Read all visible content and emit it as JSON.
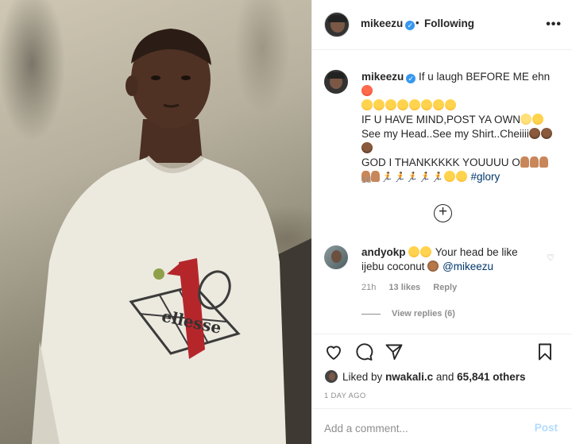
{
  "header": {
    "username": "mikeezu",
    "dot": "•",
    "follow_status": "Following",
    "more": "•••"
  },
  "caption": {
    "username": "mikeezu",
    "line1": "If u laugh BEFORE ME ehn",
    "line3": "IF U HAVE MIND,POST YA OWN",
    "line4": "See my Head..See my Shirt..Cheiiii",
    "line6": "GOD I THANKKKKK YOUUUU O",
    "hashtag": "#glory",
    "time": "1d"
  },
  "comment": {
    "username": "andyokp",
    "text1": "Your head be like",
    "text2": "ijebu coconut",
    "mention": "@mikeezu",
    "time": "21h",
    "likes": "13 likes",
    "reply": "Reply",
    "view_replies": "View replies (6)"
  },
  "likes": {
    "prefix": "Liked by",
    "user": "nwakali.c",
    "and": "and",
    "others": "65,841 others"
  },
  "post_age": "1 DAY AGO",
  "add_comment": {
    "placeholder": "Add a comment...",
    "post_label": "Post"
  },
  "shirt_text": "ellesse",
  "colors": {
    "link": "#00376b",
    "verified": "#3897f0",
    "post_disabled": "#b3dbff",
    "muted": "#8e8e8e"
  }
}
